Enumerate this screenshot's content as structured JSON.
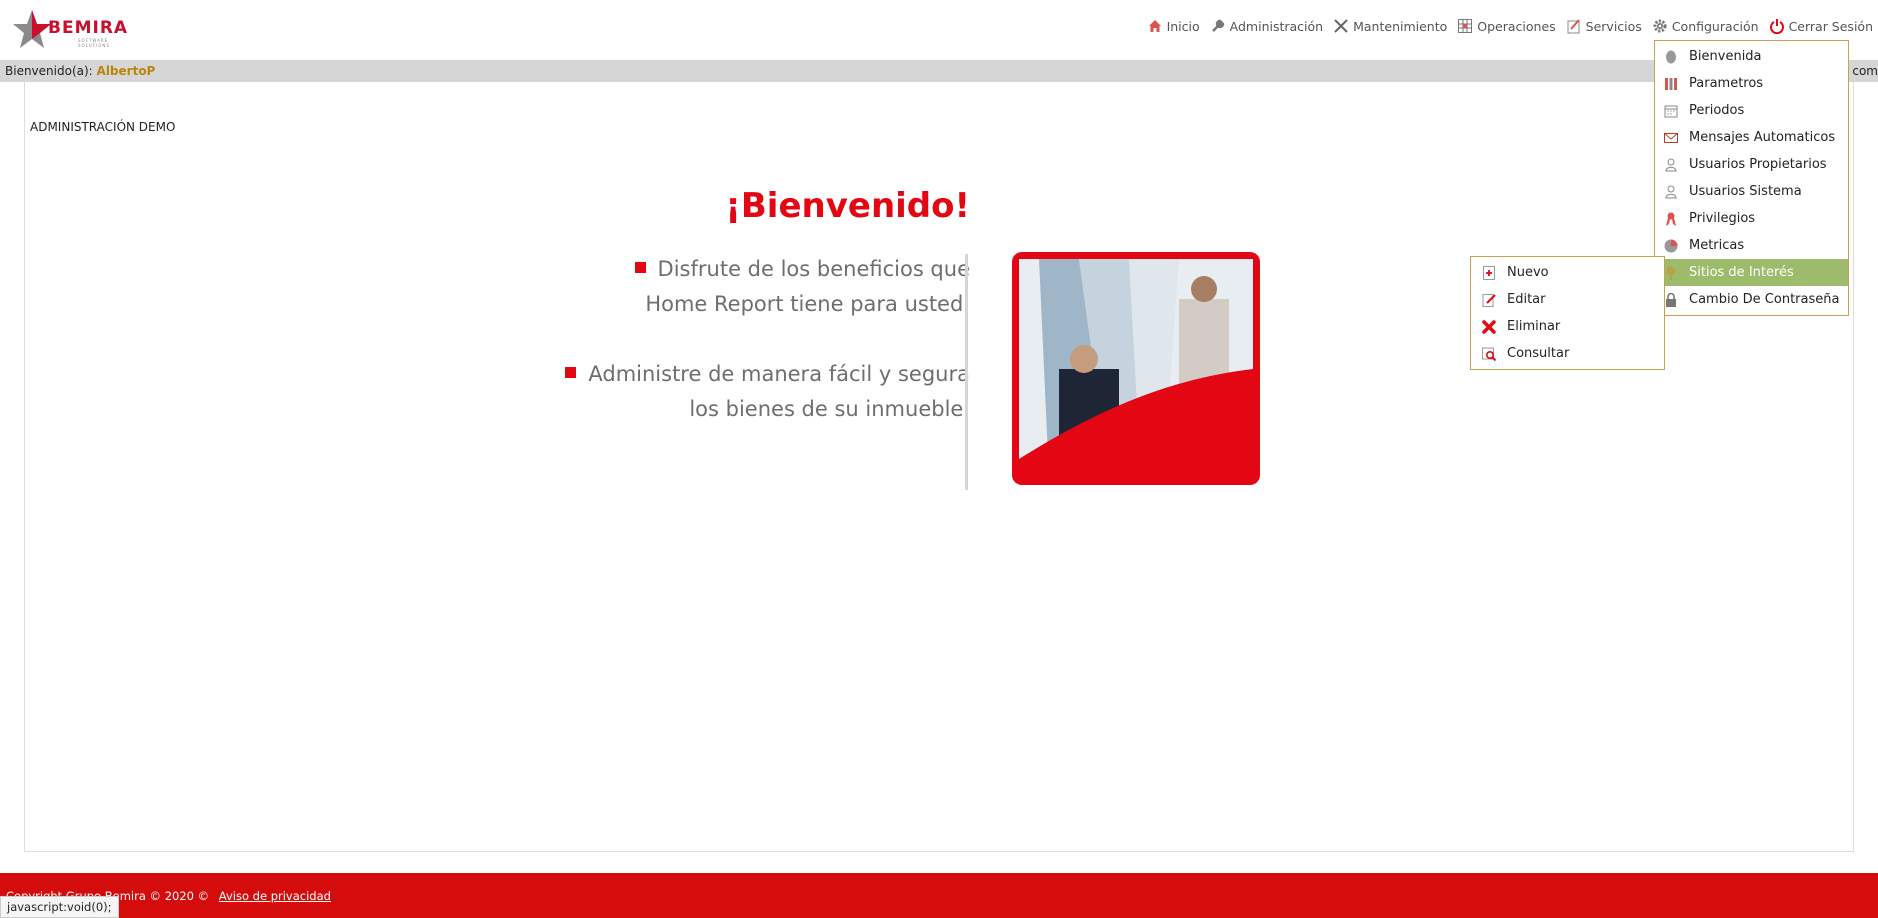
{
  "brand": {
    "logo_text": "BEMIRA",
    "logo_sub": "SOFTWARE SOLUTIONS"
  },
  "nav": [
    {
      "label": "Inicio",
      "icon": "home-icon"
    },
    {
      "label": "Administración",
      "icon": "wrench-icon"
    },
    {
      "label": "Mantenimiento",
      "icon": "tools-icon"
    },
    {
      "label": "Operaciones",
      "icon": "grid-icon"
    },
    {
      "label": "Servicios",
      "icon": "services-icon"
    },
    {
      "label": "Configuración",
      "icon": "gear-icon"
    },
    {
      "label": "Cerrar Sesión",
      "icon": "power-icon"
    }
  ],
  "welcome_bar": {
    "prefix": "Bienvenido(a):",
    "user": "AlbertoP",
    "suffix": "com"
  },
  "main": {
    "org": "ADMINISTRACIÓN DEMO",
    "title": "¡Bienvenido!",
    "bullets": [
      {
        "line1": "Disfrute de los beneficios que",
        "line2": "Home Report tiene para usted."
      },
      {
        "line1": "Administre de manera fácil y segura",
        "line2": "los bienes de su inmueble."
      }
    ]
  },
  "config_menu": [
    {
      "label": "Bienvenida",
      "icon": "leaf-icon"
    },
    {
      "label": "Parametros",
      "icon": "parameters-icon"
    },
    {
      "label": "Periodos",
      "icon": "calendar-icon"
    },
    {
      "label": "Mensajes Automaticos",
      "icon": "envelope-icon"
    },
    {
      "label": "Usuarios Propietarios",
      "icon": "user-icon"
    },
    {
      "label": "Usuarios Sistema",
      "icon": "user-icon"
    },
    {
      "label": "Privilegios",
      "icon": "ribbon-icon"
    },
    {
      "label": "Metricas",
      "icon": "pie-icon"
    },
    {
      "label": "Sitios de Interés",
      "icon": "pin-icon",
      "active": true
    },
    {
      "label": "Cambio De Contraseña",
      "icon": "lock-icon"
    }
  ],
  "sub_menu": [
    {
      "label": "Nuevo",
      "icon": "new-icon"
    },
    {
      "label": "Editar",
      "icon": "edit-icon"
    },
    {
      "label": "Eliminar",
      "icon": "delete-icon"
    },
    {
      "label": "Consultar",
      "icon": "search-icon"
    }
  ],
  "footer": {
    "copyright": "Copyright Grupo Bemira © 2020 ©",
    "privacy": "Aviso de privacidad"
  },
  "status_bar": "javascript:void(0);",
  "colors": {
    "brand_red": "#e30613",
    "footer_red": "#d40c0c",
    "menu_active": "#9cbb6b",
    "menu_border": "#c9a050"
  }
}
